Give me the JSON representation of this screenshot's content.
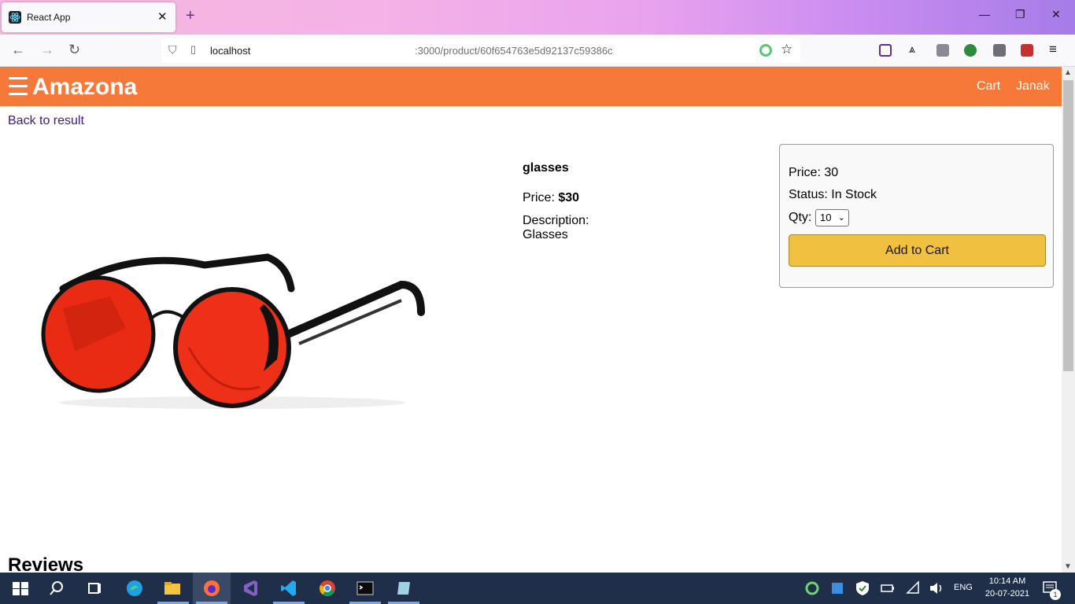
{
  "browser": {
    "tab_title": "React App",
    "url_host": "localhost",
    "url_path": ":3000/product/60f654763e5d92137c59386c"
  },
  "header": {
    "brand": "Amazona",
    "cart_link": "Cart",
    "user_link": "Janak"
  },
  "back_link": "Back to result",
  "product": {
    "name": "glasses",
    "price_label": "Price: ",
    "price_value": "$30",
    "description_label": "Description:",
    "description_value": "Glasses"
  },
  "card": {
    "price_text": "Price: 30",
    "status_text": "Status: In Stock",
    "qty_label": "Qty:",
    "qty_value": "10",
    "add_to_cart": "Add to Cart"
  },
  "reviews_heading": "Reviews",
  "taskbar": {
    "language": "ENG",
    "time": "10:14 AM",
    "date": "20-07-2021",
    "notification_count": "1"
  }
}
